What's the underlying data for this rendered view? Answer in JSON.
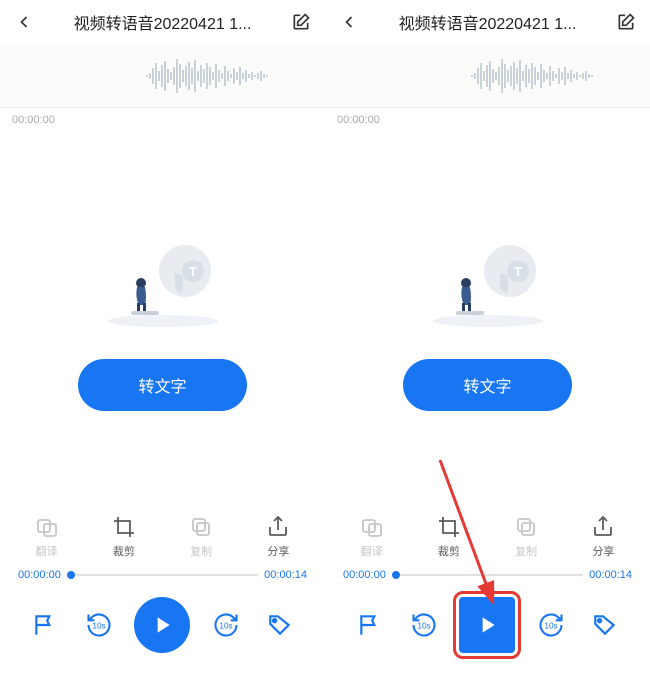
{
  "screens": [
    {
      "header": {
        "title": "视频转语音20220421 1..."
      },
      "timestamp": "00:00:00",
      "convert_label": "转文字",
      "toolbar": [
        {
          "key": "translate",
          "label": "翻译",
          "disabled": true
        },
        {
          "key": "crop",
          "label": "裁剪",
          "disabled": false
        },
        {
          "key": "copy",
          "label": "复制",
          "disabled": true
        },
        {
          "key": "share",
          "label": "分享",
          "disabled": false
        }
      ],
      "timeline": {
        "start": "00:00:00",
        "end": "00:00:14"
      },
      "play_highlighted": false
    },
    {
      "header": {
        "title": "视频转语音20220421 1..."
      },
      "timestamp": "00:00:00",
      "convert_label": "转文字",
      "toolbar": [
        {
          "key": "translate",
          "label": "翻译",
          "disabled": true
        },
        {
          "key": "crop",
          "label": "裁剪",
          "disabled": false
        },
        {
          "key": "copy",
          "label": "复制",
          "disabled": true
        },
        {
          "key": "share",
          "label": "分享",
          "disabled": false
        }
      ],
      "timeline": {
        "start": "00:00:00",
        "end": "00:00:14"
      },
      "play_highlighted": true
    }
  ],
  "colors": {
    "accent": "#1876f2",
    "highlight": "#e53935"
  }
}
